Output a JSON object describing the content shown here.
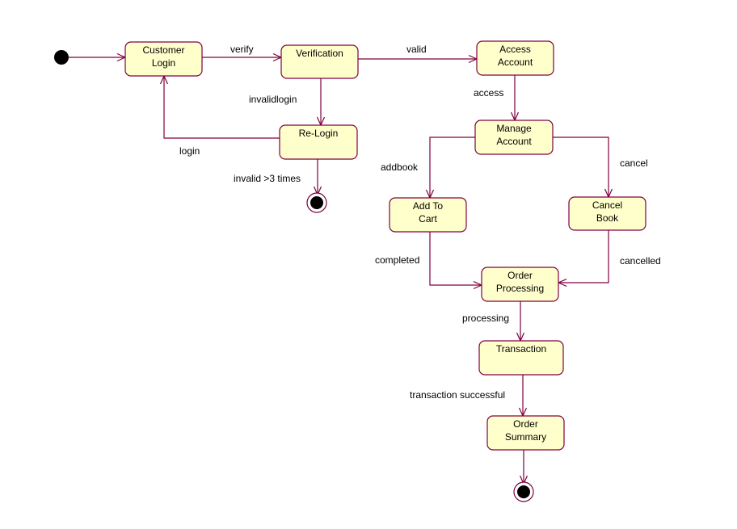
{
  "diagram": {
    "type": "UML state machine diagram",
    "colors": {
      "state_fill": "#FFFFCC",
      "line": "#800040",
      "pseudo_fill": "#000000",
      "text": "#000000",
      "background": "#FFFFFF"
    },
    "states": [
      {
        "id": "customer-login",
        "lines": [
          "Customer",
          "Login"
        ]
      },
      {
        "id": "verification",
        "lines": [
          "Verification"
        ]
      },
      {
        "id": "re-login",
        "lines": [
          "Re-Login"
        ]
      },
      {
        "id": "access-account",
        "lines": [
          "Access",
          "Account"
        ]
      },
      {
        "id": "manage-account",
        "lines": [
          "Manage",
          "Account"
        ]
      },
      {
        "id": "add-to-cart",
        "lines": [
          "Add To",
          "Cart"
        ]
      },
      {
        "id": "cancel-book",
        "lines": [
          "Cancel",
          "Book"
        ]
      },
      {
        "id": "order-processing",
        "lines": [
          "Order",
          "Processing"
        ]
      },
      {
        "id": "transaction",
        "lines": [
          "Transaction"
        ]
      },
      {
        "id": "order-summary",
        "lines": [
          "Order",
          "Summary"
        ]
      }
    ],
    "pseudostates": [
      {
        "id": "initial",
        "kind": "initial"
      },
      {
        "id": "final-relogin",
        "kind": "final"
      },
      {
        "id": "final-summary",
        "kind": "final"
      }
    ],
    "transitions": [
      {
        "id": "t-start",
        "from": "initial",
        "to": "customer-login",
        "label": ""
      },
      {
        "id": "t-verify",
        "from": "customer-login",
        "to": "verification",
        "label": "verify"
      },
      {
        "id": "t-valid",
        "from": "verification",
        "to": "access-account",
        "label": "valid"
      },
      {
        "id": "t-invalidlogin",
        "from": "verification",
        "to": "re-login",
        "label": "invalidlogin"
      },
      {
        "id": "t-login",
        "from": "re-login",
        "to": "customer-login",
        "label": "login"
      },
      {
        "id": "t-invalid3",
        "from": "re-login",
        "to": "final-relogin",
        "label": "invalid >3 times"
      },
      {
        "id": "t-access",
        "from": "access-account",
        "to": "manage-account",
        "label": "access"
      },
      {
        "id": "t-addbook",
        "from": "manage-account",
        "to": "add-to-cart",
        "label": "addbook"
      },
      {
        "id": "t-cancel",
        "from": "manage-account",
        "to": "cancel-book",
        "label": "cancel"
      },
      {
        "id": "t-completed",
        "from": "add-to-cart",
        "to": "order-processing",
        "label": "completed"
      },
      {
        "id": "t-cancelled",
        "from": "cancel-book",
        "to": "order-processing",
        "label": "cancelled"
      },
      {
        "id": "t-processing",
        "from": "order-processing",
        "to": "transaction",
        "label": "processing"
      },
      {
        "id": "t-success",
        "from": "transaction",
        "to": "order-summary",
        "label": "transaction successful"
      },
      {
        "id": "t-end",
        "from": "order-summary",
        "to": "final-summary",
        "label": ""
      }
    ]
  }
}
